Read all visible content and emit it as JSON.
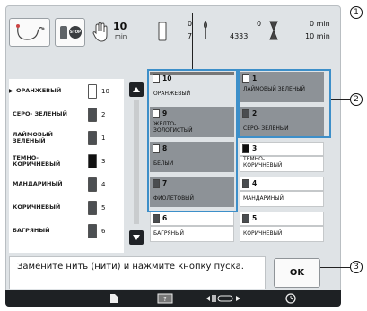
{
  "toolbar": {
    "stop_label": "STOP",
    "stitch_count": "10",
    "stitch_unit": "min",
    "thread_current": "0",
    "thread_total": "7",
    "stitch_current": "0",
    "stitch_total": "4333",
    "time_current": "0 min",
    "time_total": "10 min"
  },
  "thread_list": [
    {
      "name": "ОРАНЖЕВЫЙ",
      "number": "10",
      "spool": "light",
      "current": true
    },
    {
      "name": "СЕРО- ЗЕЛЕНЫЙ",
      "number": "2",
      "spool": "dark"
    },
    {
      "name": "ЛАЙМОВЫЙ ЗЕЛЕНЫЙ",
      "number": "1",
      "spool": "dark"
    },
    {
      "name": "ТЕМНО- КОРИЧНЕВЫЙ",
      "number": "3",
      "spool": "black"
    },
    {
      "name": "МАНДАРИНЫЙ",
      "number": "4",
      "spool": "dark"
    },
    {
      "name": "КОРИЧНЕВЫЙ",
      "number": "5",
      "spool": "dark"
    },
    {
      "name": "БАГРЯНЫЙ",
      "number": "6",
      "spool": "dark"
    }
  ],
  "color_grid": [
    {
      "number": "10",
      "name": "ОРАНЖЕВЫЙ",
      "style": "selected",
      "swatch": "light"
    },
    {
      "number": "1",
      "name": "ЛАЙМОВЫЙ ЗЕЛЕНЫЙ",
      "style": "grey",
      "swatch": "light"
    },
    {
      "number": "9",
      "name": "ЖЕЛТО- ЗОЛОТИСТЫЙ",
      "style": "grey",
      "swatch": "light"
    },
    {
      "number": "2",
      "name": "СЕРО- ЗЕЛЕНЫЙ",
      "style": "grey",
      "swatch": "dark"
    },
    {
      "number": "8",
      "name": "БЕЛЫЙ",
      "style": "grey",
      "swatch": "light"
    },
    {
      "number": "3",
      "name": "ТЕМНО- КОРИЧНЕВЫЙ",
      "style": "white",
      "swatch": "black"
    },
    {
      "number": "7",
      "name": "ФИОЛЕТОВЫЙ",
      "style": "grey",
      "swatch": "dark"
    },
    {
      "number": "4",
      "name": "МАНДАРИНЫЙ",
      "style": "white",
      "swatch": "dark"
    },
    {
      "number": "6",
      "name": "БАГРЯНЫЙ",
      "style": "white",
      "swatch": "dark"
    },
    {
      "number": "5",
      "name": "КОРИЧНЕВЫЙ",
      "style": "white",
      "swatch": "dark"
    }
  ],
  "callouts": {
    "one": "1",
    "two": "2",
    "three": "3"
  },
  "message": "Замените нить (нити) и нажмите кнопку пуска.",
  "ok_label": "OK",
  "colors": {
    "callout_box": "#3d8fc9",
    "panel": "#dfe3e6",
    "grey_cell": "#8d9297",
    "bottom_bar": "#1e2124"
  },
  "icons": [
    "thread-path-icon",
    "stop-icon",
    "hand-icon",
    "spool-icon",
    "needle-icon",
    "hourglass-icon",
    "scroll-up-icon",
    "scroll-down-icon",
    "page-icon",
    "pattern-icon",
    "width-icon",
    "clock-icon"
  ]
}
